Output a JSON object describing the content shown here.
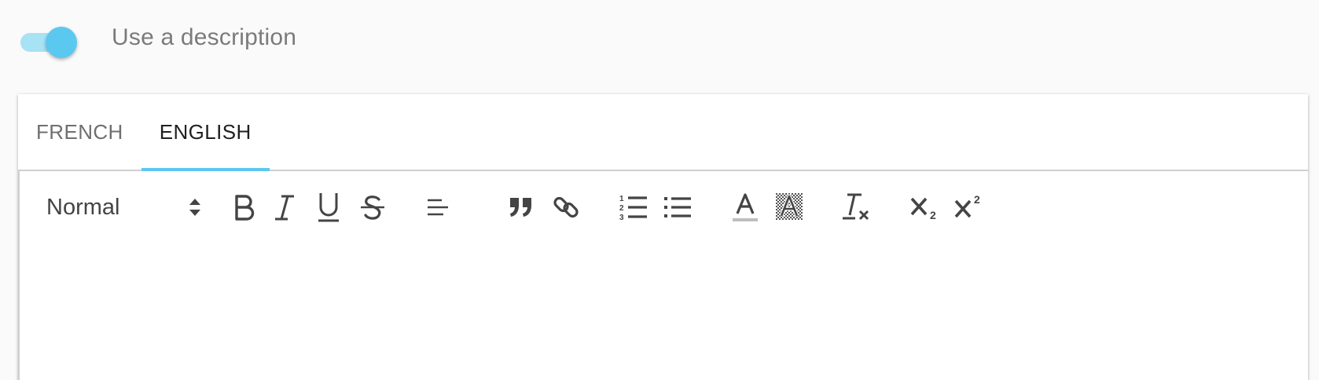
{
  "toggle": {
    "label": "Use a description",
    "checked": true,
    "track_color": "#a7e2f5",
    "thumb_color": "#5bc8f0"
  },
  "tabs": [
    {
      "label": "FRENCH",
      "active": false
    },
    {
      "label": "ENGLISH",
      "active": true
    }
  ],
  "accent_color": "#5bc8f0",
  "toolbar": {
    "header_select": {
      "value": "Normal"
    },
    "buttons": [
      {
        "name": "bold",
        "icon": "bold-icon"
      },
      {
        "name": "italic",
        "icon": "italic-icon"
      },
      {
        "name": "underline",
        "icon": "underline-icon"
      },
      {
        "name": "strikethrough",
        "icon": "strikethrough-icon"
      },
      {
        "name": "align",
        "icon": "align-left-icon"
      },
      {
        "name": "blockquote",
        "icon": "quote-icon"
      },
      {
        "name": "link",
        "icon": "link-icon"
      },
      {
        "name": "ordered-list",
        "icon": "ordered-list-icon"
      },
      {
        "name": "bullet-list",
        "icon": "bullet-list-icon"
      },
      {
        "name": "text-color",
        "icon": "text-color-icon"
      },
      {
        "name": "background-color",
        "icon": "highlight-icon"
      },
      {
        "name": "clear-format",
        "icon": "clear-format-icon"
      },
      {
        "name": "subscript",
        "icon": "subscript-icon"
      },
      {
        "name": "superscript",
        "icon": "superscript-icon"
      }
    ]
  },
  "editor": {
    "content": ""
  }
}
